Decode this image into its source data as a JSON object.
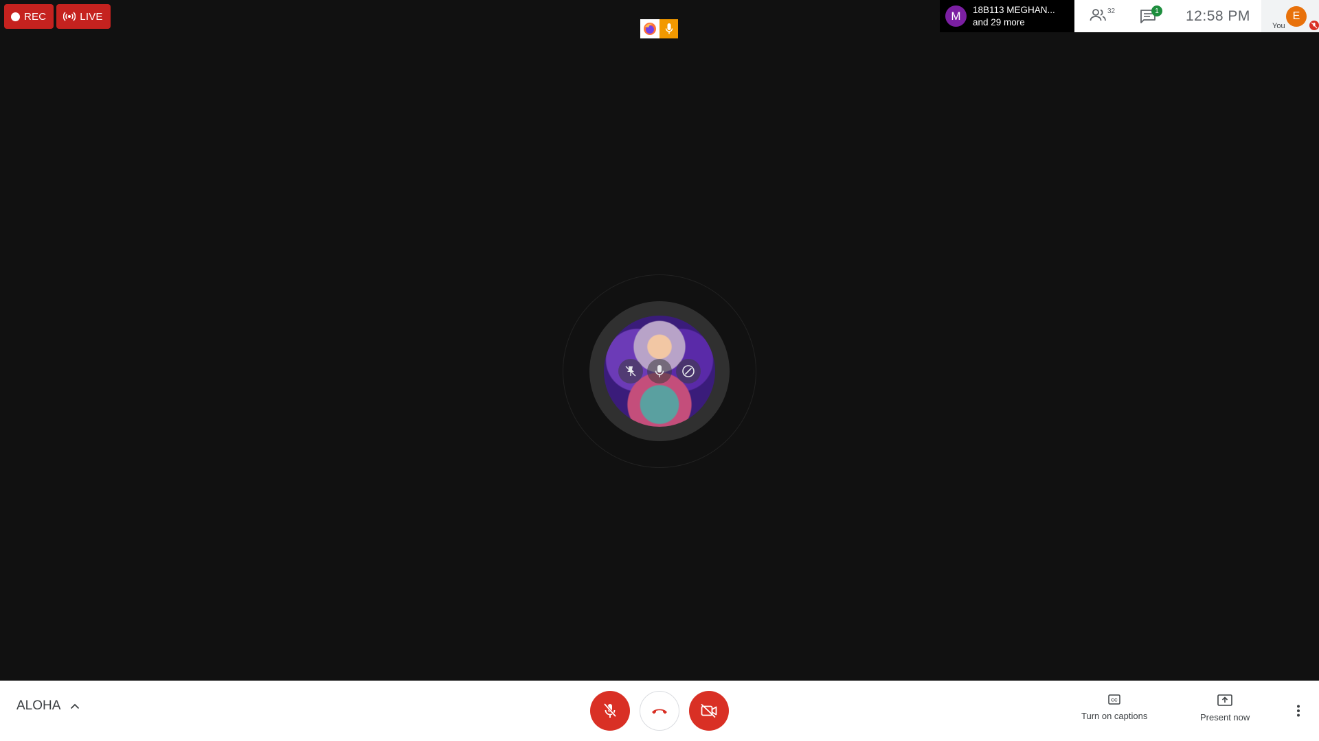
{
  "badges": {
    "rec_label": "REC",
    "live_label": "LIVE"
  },
  "participants_preview": {
    "avatar_letter": "M",
    "name": "18B113 MEGHAN...",
    "more": "and 29 more"
  },
  "topbar": {
    "people_count": "32",
    "chat_count": "1",
    "time": "12:58 PM",
    "self_avatar_letter": "E",
    "self_label": "You"
  },
  "bottombar": {
    "meeting_name": "ALOHA",
    "captions_label": "Turn on captions",
    "present_label": "Present now"
  },
  "colors": {
    "rec_red": "#c5221f",
    "control_red": "#d93025",
    "chat_green": "#1e8e3e",
    "self_orange": "#e8710a",
    "preview_purple": "#7b1fa2"
  },
  "icons": [
    "record-dot-icon",
    "broadcast-icon",
    "firefox-icon",
    "microphone-icon",
    "people-icon",
    "chat-icon",
    "mic-off-icon",
    "hang-up-icon",
    "camera-off-icon",
    "captions-icon",
    "present-icon",
    "more-vert-icon",
    "chevron-up-icon",
    "pin-icon",
    "remove-icon"
  ]
}
